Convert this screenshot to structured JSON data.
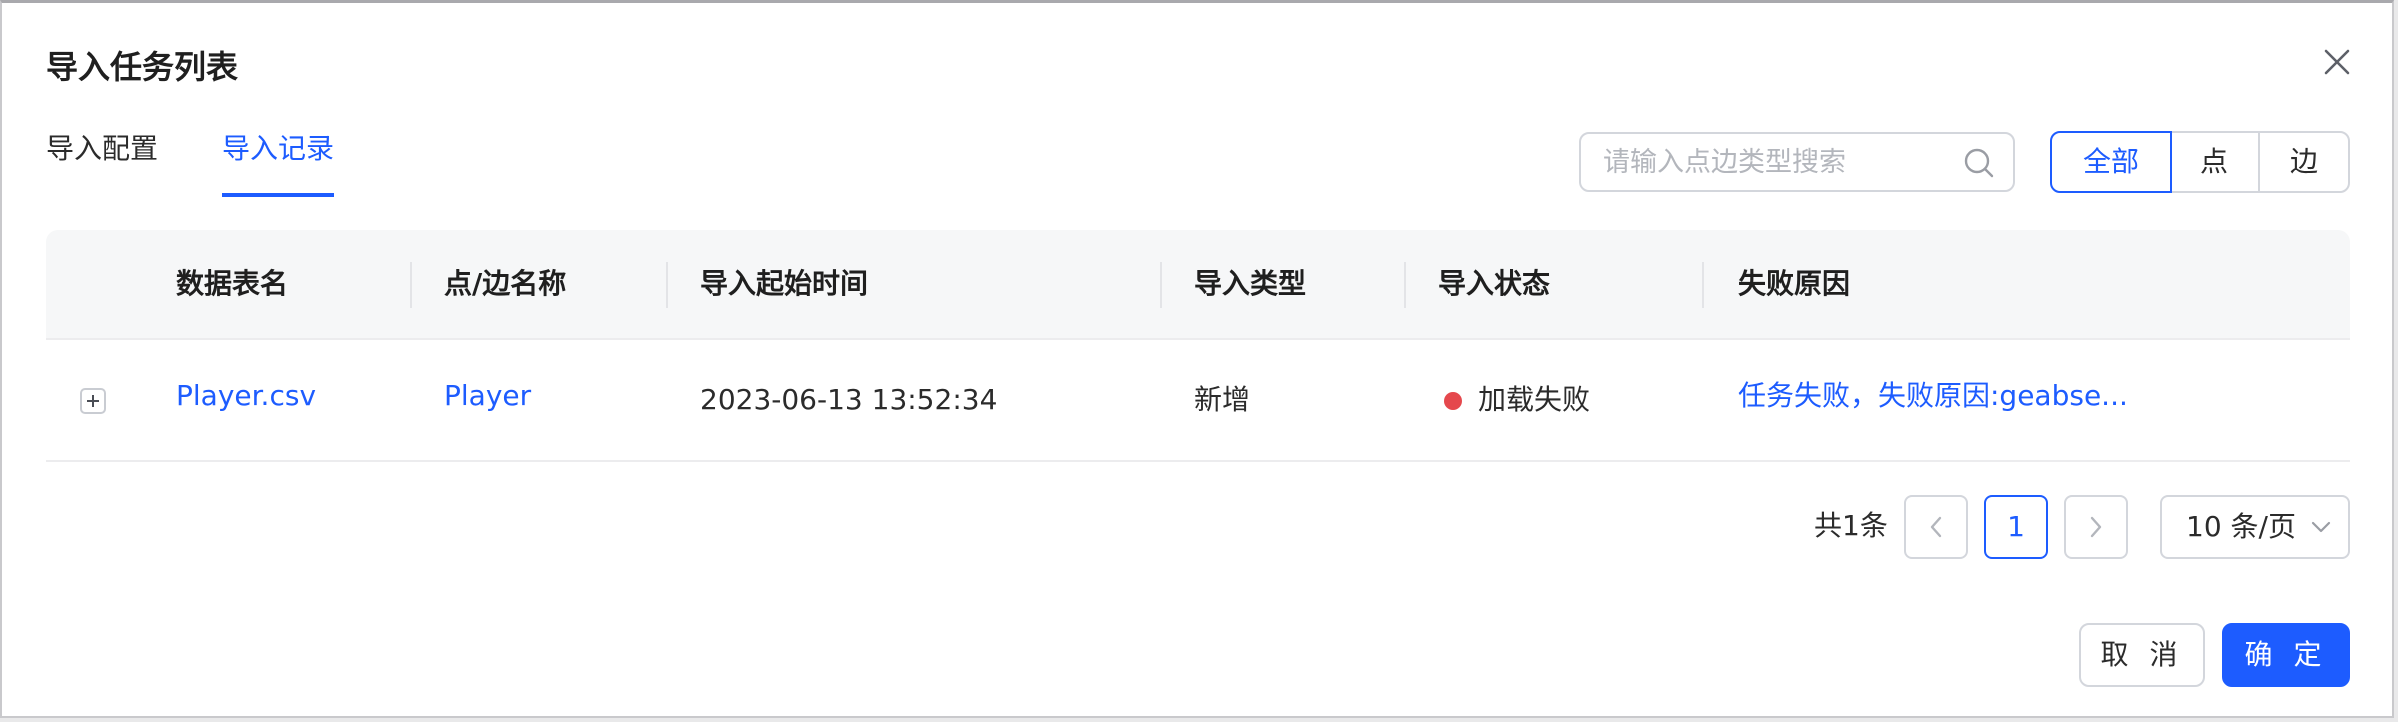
{
  "dialog": {
    "title": "导入任务列表"
  },
  "tabs": [
    {
      "label": "导入配置",
      "active": false
    },
    {
      "label": "导入记录",
      "active": true
    }
  ],
  "search": {
    "placeholder": "请输入点边类型搜索",
    "value": ""
  },
  "filter": {
    "options": [
      "全部",
      "点",
      "边"
    ],
    "selected": "全部"
  },
  "table": {
    "columns": [
      "数据表名",
      "点/边名称",
      "导入起始时间",
      "导入类型",
      "导入状态",
      "失败原因"
    ],
    "rows": [
      {
        "table_name": "Player.csv",
        "entity_name": "Player",
        "start_time": "2023-06-13 13:52:34",
        "import_type": "新增",
        "status": "加载失败",
        "status_color": "#e5484d",
        "fail_reason": "任务失败，失败原因:geabse..."
      }
    ]
  },
  "pagination": {
    "total_label": "共1条",
    "current_page": "1",
    "page_size_label": "10 条/页"
  },
  "footer": {
    "cancel_label": "取 消",
    "confirm_label": "确 定"
  },
  "colors": {
    "accent": "#1d5cff",
    "error": "#e5484d"
  }
}
